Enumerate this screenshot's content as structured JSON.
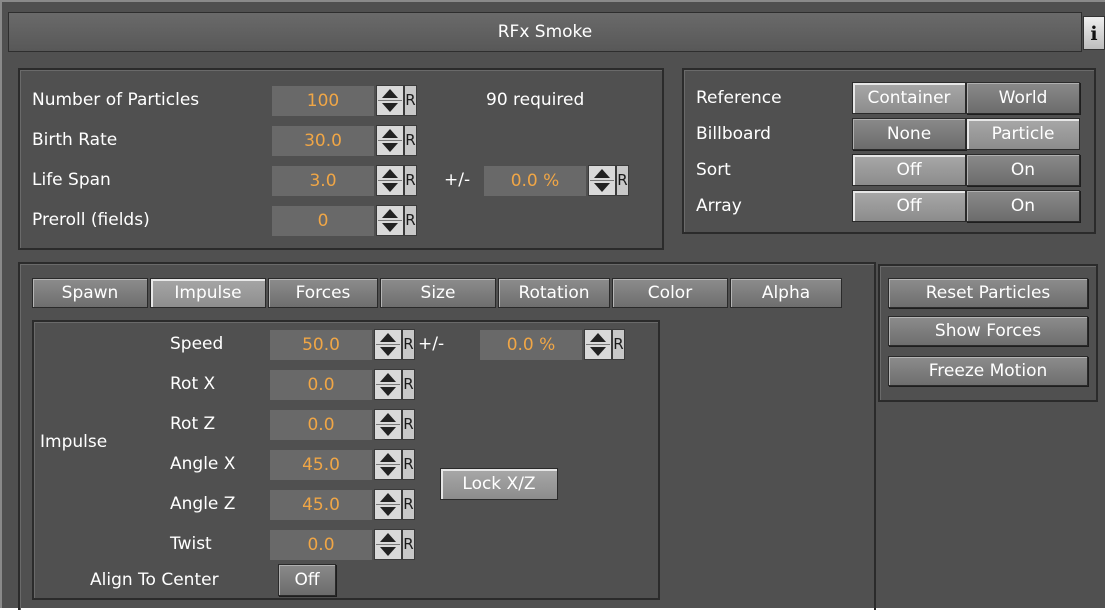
{
  "title": "RFx Smoke",
  "info_label": "i",
  "particles": {
    "rows": [
      {
        "label": "Number of Particles",
        "value": "100"
      },
      {
        "label": "Birth Rate",
        "value": "30.0"
      },
      {
        "label": "Life Span",
        "value": "3.0"
      },
      {
        "label": "Preroll (fields)",
        "value": "0"
      }
    ],
    "required_text": "90 required",
    "lifespan_variance_label": "+/-",
    "lifespan_variance_value": "0.0 %",
    "reset_label": "R"
  },
  "options": {
    "rows": [
      {
        "label": "Reference",
        "a": "Container",
        "b": "World",
        "selected": "a"
      },
      {
        "label": "Billboard",
        "a": "None",
        "b": "Particle",
        "selected": "b"
      },
      {
        "label": "Sort",
        "a": "Off",
        "b": "On",
        "selected": "a"
      },
      {
        "label": "Array",
        "a": "Off",
        "b": "On",
        "selected": "a"
      }
    ]
  },
  "tabs": [
    "Spawn",
    "Impulse",
    "Forces",
    "Size",
    "Rotation",
    "Color",
    "Alpha"
  ],
  "active_tab": "Impulse",
  "impulse": {
    "group_label": "Impulse",
    "rows": [
      {
        "label": "Speed",
        "value": "50.0"
      },
      {
        "label": "Rot X",
        "value": "0.0"
      },
      {
        "label": "Rot Z",
        "value": "0.0"
      },
      {
        "label": "Angle X",
        "value": "45.0"
      },
      {
        "label": "Angle Z",
        "value": "45.0"
      },
      {
        "label": "Twist",
        "value": "0.0"
      }
    ],
    "speed_variance_label": "+/-",
    "speed_variance_value": "0.0 %",
    "lock_label": "Lock X/Z",
    "align_label": "Align To Center",
    "align_value": "Off"
  },
  "actions": [
    "Reset Particles",
    "Show Forces",
    "Freeze Motion"
  ],
  "colors": {
    "panel_bg": "#505050",
    "value_text": "#f0a646",
    "field_bg": "#696969"
  }
}
